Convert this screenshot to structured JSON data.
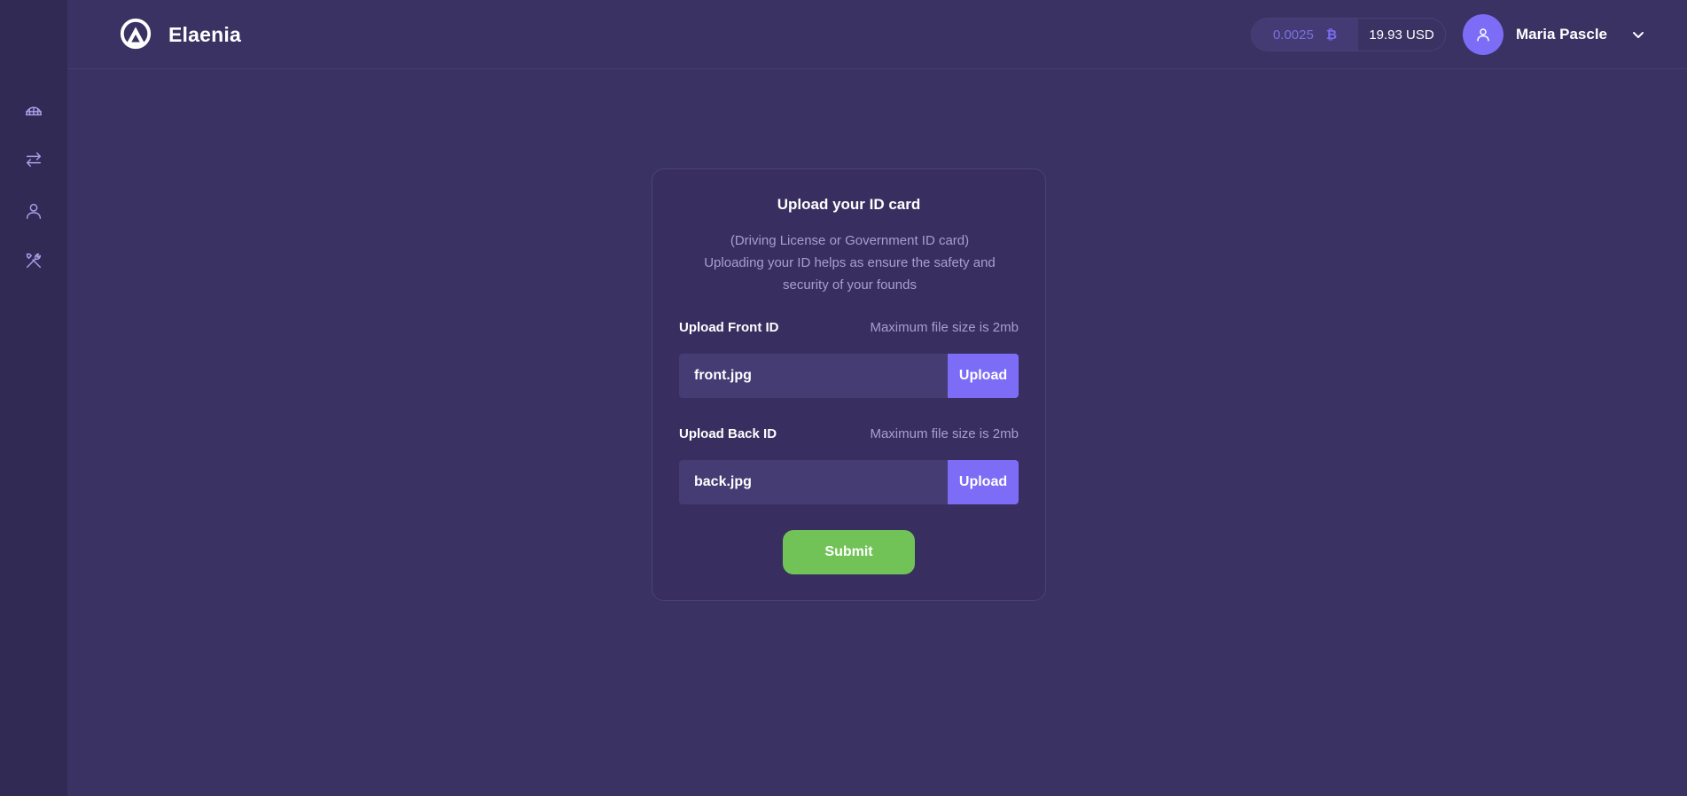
{
  "app": {
    "brand": "Elaenia"
  },
  "sidebar": {
    "items": [
      {
        "icon": "dashboard-icon"
      },
      {
        "icon": "exchange-icon"
      },
      {
        "icon": "user-icon"
      },
      {
        "icon": "tools-icon"
      }
    ]
  },
  "header": {
    "balance_crypto": "0.0025",
    "crypto_icon": "bitcoin-icon",
    "crypto_symbol": "₿",
    "balance_usd": "19.93 USD",
    "user_name": "Maria Pascle"
  },
  "card": {
    "title": "Upload your ID card",
    "description_line1": "(Driving License or Government ID card)",
    "description_line2": "Uploading your ID helps as ensure the safety and security of your founds",
    "front": {
      "label": "Upload Front ID",
      "hint": "Maximum file size is 2mb",
      "value": "front.jpg",
      "button": "Upload"
    },
    "back": {
      "label": "Upload Back ID",
      "hint": "Maximum file size is 2mb",
      "value": "back.jpg",
      "button": "Upload"
    },
    "submit": "Submit"
  },
  "colors": {
    "background": "#3a3262",
    "sidebar": "#312a55",
    "accent": "#7c6cf6",
    "submit": "#72c357"
  }
}
